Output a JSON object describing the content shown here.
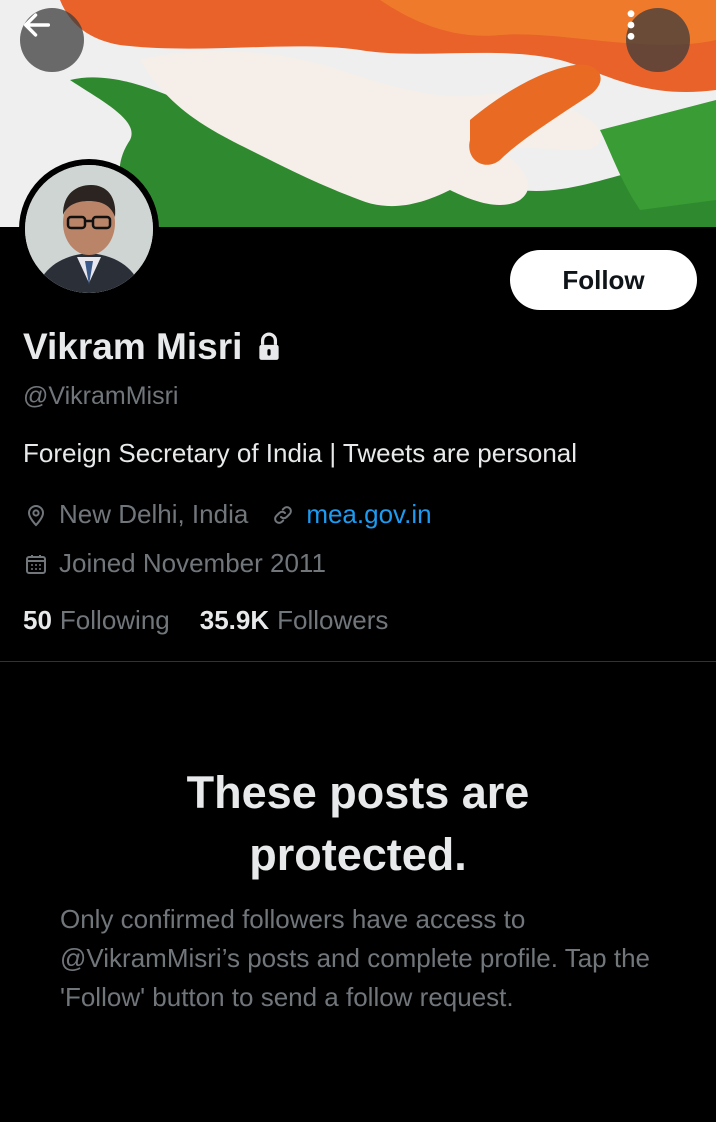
{
  "header": {
    "back_icon": "arrow-left-icon",
    "more_icon": "more-vertical-icon"
  },
  "profile": {
    "name": "Vikram Misri",
    "handle": "@VikramMisri",
    "bio": "Foreign Secretary of India | Tweets are personal",
    "location": "New Delhi, India",
    "website": "mea.gov.in",
    "joined": "Joined November 2011",
    "following_count": "50",
    "following_label": "Following",
    "followers_count": "35.9K",
    "followers_label": "Followers",
    "protected_icon": "lock-icon"
  },
  "actions": {
    "follow_label": "Follow"
  },
  "protected": {
    "title": "These posts are protected.",
    "body": "Only confirmed followers have access to @VikramMisri’s posts and complete profile. Tap the 'Follow' button to send a follow request."
  },
  "colors": {
    "background": "#000000",
    "text_primary": "#e7e9ea",
    "text_secondary": "#71767b",
    "link": "#1d9bf0",
    "divider": "#2f3336"
  }
}
